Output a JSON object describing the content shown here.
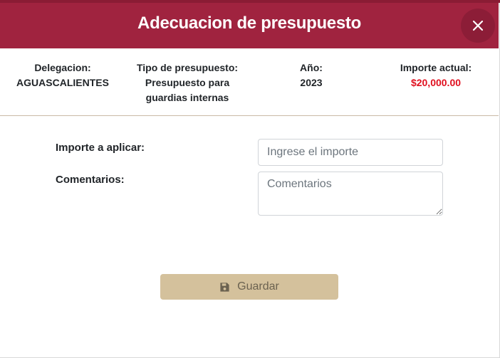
{
  "modal": {
    "title": "Adecuacion de presupuesto",
    "close_icon": "close-icon"
  },
  "info": {
    "delegacion_label": "Delegacion:",
    "delegacion_value": "AGUASCALIENTES",
    "tipo_label": "Tipo de presupuesto:",
    "tipo_value_line1": "Presupuesto para",
    "tipo_value_line2": "guardias internas",
    "anio_label": "Año:",
    "anio_value": "2023",
    "importe_label": "Importe actual:",
    "importe_value": "$20,000.00"
  },
  "form": {
    "importe_label": "Importe a aplicar:",
    "importe_placeholder": "Ingrese el importe",
    "comentarios_label": "Comentarios:",
    "comentarios_placeholder": "Comentarios"
  },
  "actions": {
    "save_label": "Guardar",
    "save_icon": "floppy-disk-icon"
  },
  "colors": {
    "header": "#a0233f",
    "close_button": "#8c1d37",
    "importe_value": "#e0101f",
    "save_button": "#d4c19c"
  }
}
